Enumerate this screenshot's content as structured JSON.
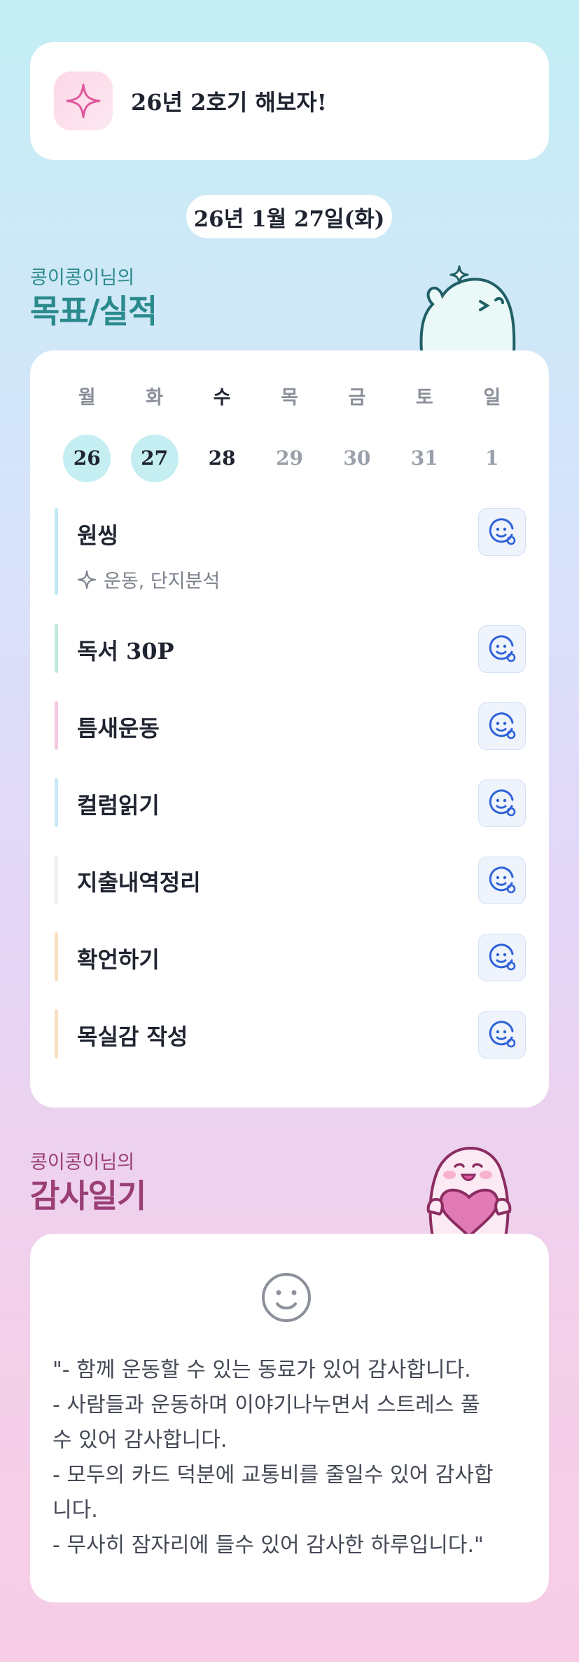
{
  "banner": {
    "title": "26년 2호기 해보자!",
    "icon": "sparkle-icon"
  },
  "date_label": "26년 1월 27일(화)",
  "goals_section": {
    "subtitle": "콩이콩이님의",
    "title": "목표/실적"
  },
  "week": [
    {
      "day": "월",
      "date": "26",
      "state": "done"
    },
    {
      "day": "화",
      "date": "27",
      "state": "done"
    },
    {
      "day": "수",
      "date": "28",
      "state": "today"
    },
    {
      "day": "목",
      "date": "29",
      "state": "future"
    },
    {
      "day": "금",
      "date": "30",
      "state": "future"
    },
    {
      "day": "토",
      "date": "31",
      "state": "future"
    },
    {
      "day": "일",
      "date": "1",
      "state": "future"
    }
  ],
  "goals": [
    {
      "name": "원씽",
      "tags": "운동, 단지분석",
      "color": "#bfe9f3"
    },
    {
      "name": "독서 30P",
      "color": "#bfe9d8"
    },
    {
      "name": "틈새운동",
      "color": "#f5c9e2"
    },
    {
      "name": "컬럼읽기",
      "color": "#c9e8f8"
    },
    {
      "name": "지출내역정리",
      "color": "#eeeff4"
    },
    {
      "name": "확언하기",
      "color": "#f9e0c2"
    },
    {
      "name": "목실감 작성",
      "color": "#f9e0c2"
    }
  ],
  "diary_section": {
    "subtitle": "콩이콩이님의",
    "title": "감사일기"
  },
  "diary_text": "\"- 함께 운동할 수 있는 동료가 있어 감사합니다.\n- 사람들과 운동하며 이야기나누면서 스트레스 풀\n수 있어 감사합니다.\n- 모두의 카드 덕분에 교통비를 줄일수 있어 감사합\n니다.\n- 무사히 잠자리에 들수 있어 감사한 하루입니다.\"",
  "colors": {
    "goals_title": "#2a8a8c",
    "diary_title": "#9a3e76",
    "button_icon": "#2f62d8"
  }
}
